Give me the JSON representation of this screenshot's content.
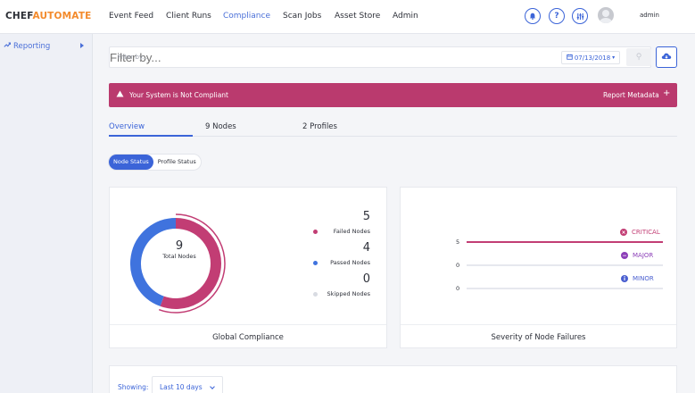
{
  "app": {
    "logo_part1": "CHEF",
    "logo_part2": "AUTOMATE"
  },
  "nav": {
    "items": [
      {
        "label": "Event Feed",
        "active": false
      },
      {
        "label": "Client Runs",
        "active": false
      },
      {
        "label": "Compliance",
        "active": true
      },
      {
        "label": "Scan Jobs",
        "active": false
      },
      {
        "label": "Asset Store",
        "active": false
      },
      {
        "label": "Admin",
        "active": false
      }
    ],
    "icons": [
      "bell-icon",
      "help-icon",
      "settings-sliders-icon"
    ],
    "user": "admin"
  },
  "sidebar": {
    "items": [
      {
        "label": "Reporting",
        "icon": "chart-icon"
      }
    ]
  },
  "filter": {
    "placeholder": "Filter by...",
    "date": "07/13/2018"
  },
  "banner": {
    "message": "Your System is Not Compliant",
    "action": "Report Metadata",
    "plus": "+"
  },
  "tabs": [
    {
      "label": "Overview",
      "active": true
    },
    {
      "label": "9 Nodes",
      "active": false
    },
    {
      "label": "2 Profiles",
      "active": false
    }
  ],
  "toggle": {
    "options": [
      "Node Status",
      "Profile Status"
    ],
    "selected": "Node Status"
  },
  "global_compliance": {
    "title": "Global Compliance",
    "total_value": "9",
    "total_label": "Total Nodes",
    "legend": [
      {
        "value": "5",
        "label": "Failed Nodes",
        "color": "#c23d74"
      },
      {
        "value": "4",
        "label": "Passed Nodes",
        "color": "#3f73de"
      },
      {
        "value": "0",
        "label": "Skipped Nodes",
        "color": "#d8dbe2"
      }
    ]
  },
  "severity": {
    "title": "Severity of Node Failures",
    "rows": [
      {
        "value": "5",
        "label": "CRITICAL",
        "color": "#c23d74",
        "fraction": 1.0
      },
      {
        "value": "0",
        "label": "MAJOR",
        "color": "#8c3fb8",
        "fraction": 0.0
      },
      {
        "value": "0",
        "label": "MINOR",
        "color": "#4a5fd0",
        "fraction": 0.0
      }
    ]
  },
  "showing": {
    "label": "Showing:",
    "value": "Last 10 days"
  },
  "colors": {
    "accent": "#3b64d8",
    "banner": "#ba3a6e",
    "failed": "#c23d74",
    "passed": "#3f73de"
  }
}
